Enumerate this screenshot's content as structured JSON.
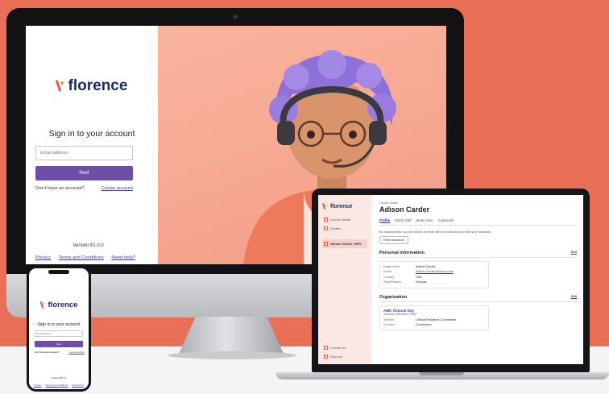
{
  "brand": {
    "name": "florence",
    "logo_mark": "florence-flame-icon",
    "accent": "#6e4ea8",
    "coral": "#e97057"
  },
  "monitor_login": {
    "title": "Sign in to your account",
    "email_placeholder": "Email address",
    "next_label": "Next",
    "no_account_text": "Don't have an account?",
    "create_account_label": "Create account",
    "version": "Version 81.0.0",
    "footer": {
      "privacy": "Privacy",
      "terms": "Terms and Conditions",
      "help": "Need help?"
    }
  },
  "laptop_app": {
    "sidebar": {
      "items": [
        {
          "label": "Lincoln Health",
          "icon": "building-icon"
        },
        {
          "label": "Studies",
          "icon": "folder-icon"
        }
      ],
      "active_user": "Adison Carder, MPH",
      "bottom": [
        {
          "label": "Contact us",
          "icon": "help-icon"
        },
        {
          "label": "Sign out",
          "icon": "sign-out-icon"
        }
      ]
    },
    "breadcrumb": "Lincoln Health",
    "profile_name": "Adison Carder",
    "tabs": [
      "Profile",
      "Study Staff",
      "Study roles",
      "Audit trails"
    ],
    "reset_note": "By clicking below, you will receive an email with the instructions to reset your password.",
    "reset_button": "Reset password",
    "personal_info": {
      "heading": "Personal Information",
      "edit": "Edit",
      "rows": [
        {
          "label": "Legal name",
          "value": "Adison Carder"
        },
        {
          "label": "Email",
          "value": "Adison.Carder@strong.com"
        },
        {
          "label": "Country",
          "value": "USA"
        },
        {
          "label": "State/Region",
          "value": "Georgia"
        }
      ]
    },
    "organization": {
      "heading": "Organization",
      "edit": "Edit",
      "name": "AMC Clinical Org",
      "subtitle": "Academic Medical Center",
      "rows": [
        {
          "label": "Job title",
          "value": "Clinical Research Coordinator"
        },
        {
          "label": "Function",
          "value": "Coordinator"
        }
      ]
    }
  },
  "phone_login": {
    "title": "Sign in to your account",
    "email_placeholder": "Email address",
    "next_label": "Next",
    "no_account_text": "Don't have an account?",
    "create_account_label": "Create account",
    "version": "Version 81.0.0",
    "footer": {
      "privacy": "Privacy",
      "terms": "Terms and Conditions",
      "help": "Need help?"
    }
  }
}
